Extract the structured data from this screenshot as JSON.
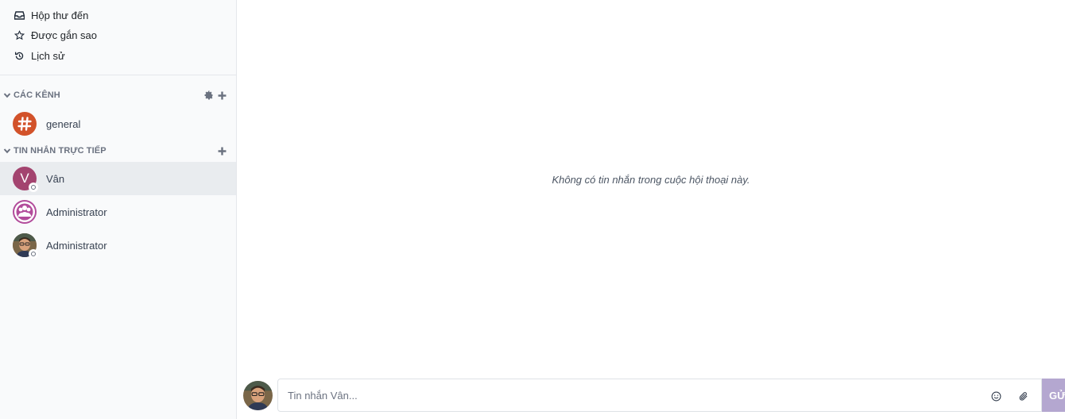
{
  "sidebar": {
    "mailboxes": [
      {
        "label": "Hộp thư đến",
        "icon": "inbox-icon"
      },
      {
        "label": "Được gắn sao",
        "icon": "star-icon"
      },
      {
        "label": "Lịch sử",
        "icon": "history-icon"
      }
    ],
    "channels_category": {
      "label": "CÁC KÊNH"
    },
    "channels": [
      {
        "name": "general",
        "icon": "hash-icon",
        "color": "#d2522a"
      }
    ],
    "direct_category": {
      "label": "TIN NHẮN TRỰC TIẾP"
    },
    "direct_messages": [
      {
        "name": "Vân",
        "avatar_letter": "V",
        "avatar_color": "#a3446f",
        "active": true
      },
      {
        "name": "Administrator",
        "avatar_color": "#b24c9b"
      },
      {
        "name": "Administrator",
        "avatar_color": "#8a6a4a"
      }
    ]
  },
  "thread": {
    "empty_message": "Không có tin nhắn trong cuộc hội thoại này."
  },
  "composer": {
    "placeholder": "Tin nhắn Vân...",
    "send_label": "GỬI",
    "send_color": "#b4a7d0"
  }
}
